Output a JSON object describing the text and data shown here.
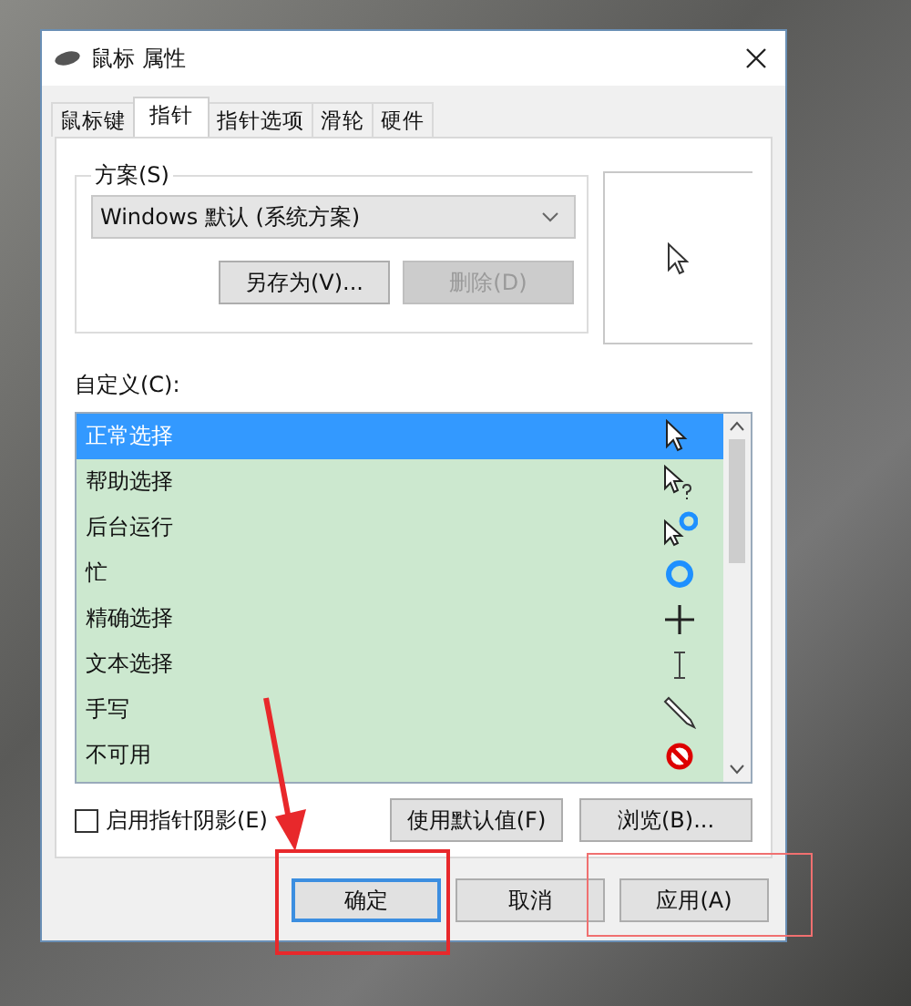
{
  "window": {
    "title": "鼠标 属性"
  },
  "tabs": [
    {
      "label": "鼠标键",
      "selected": false
    },
    {
      "label": "指针",
      "selected": true
    },
    {
      "label": "指针选项",
      "selected": false
    },
    {
      "label": "滑轮",
      "selected": false
    },
    {
      "label": "硬件",
      "selected": false
    }
  ],
  "scheme": {
    "label": "方案(S)",
    "value": "Windows 默认 (系统方案)",
    "buttons": [
      {
        "label": "另存为(V)...",
        "disabled": false
      },
      {
        "label": "删除(D)",
        "disabled": true
      }
    ]
  },
  "customize": {
    "label": "自定义(C):",
    "rows": [
      {
        "name": "正常选择",
        "kind": "arrow",
        "selected": true
      },
      {
        "name": "帮助选择",
        "kind": "help",
        "selected": false
      },
      {
        "name": "后台运行",
        "kind": "working",
        "selected": false
      },
      {
        "name": "忙",
        "kind": "busy",
        "selected": false
      },
      {
        "name": "精确选择",
        "kind": "cross",
        "selected": false
      },
      {
        "name": "文本选择",
        "kind": "beam",
        "selected": false
      },
      {
        "name": "手写",
        "kind": "pen",
        "selected": false
      },
      {
        "name": "不可用",
        "kind": "unavailable",
        "selected": false
      }
    ]
  },
  "shadow_checkbox": {
    "label": "启用指针阴影(E)",
    "checked": false
  },
  "list_buttons": [
    "使用默认值(F)",
    "浏览(B)..."
  ],
  "dialog_buttons": [
    {
      "label": "确定",
      "default": true,
      "highlighted": true,
      "arrow": true
    },
    {
      "label": "取消",
      "default": false,
      "highlighted": false,
      "arrow": false
    },
    {
      "label": "应用(A)",
      "default": false,
      "highlighted": true,
      "arrow": false
    }
  ]
}
